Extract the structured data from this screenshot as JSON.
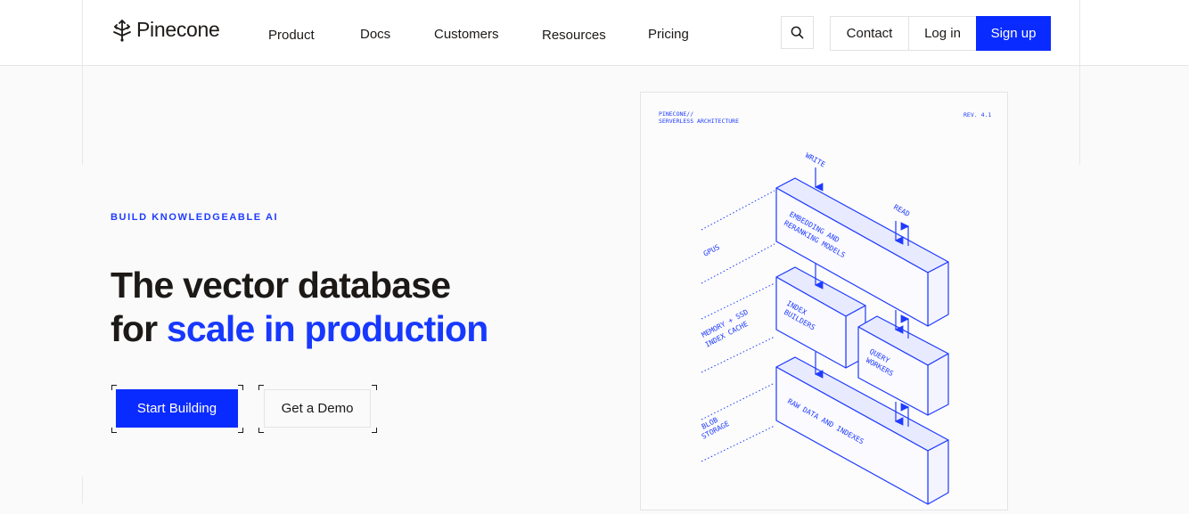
{
  "brand": {
    "name": "Pinecone",
    "logo_icon": "pinecone-logo-icon"
  },
  "nav": {
    "items": [
      "Product",
      "Docs",
      "Customers",
      "Resources",
      "Pricing"
    ]
  },
  "header_actions": {
    "search_icon": "search-icon",
    "contact": "Contact",
    "login": "Log in",
    "signup": "Sign up"
  },
  "hero": {
    "eyebrow": "BUILD KNOWLEDGEABLE AI",
    "headline_line1": "The vector database",
    "headline_line2_plain": "for ",
    "headline_line2_accent": "scale in production",
    "cta_primary": "Start Building",
    "cta_secondary": "Get a Demo"
  },
  "diagram": {
    "header_left_1": "PINECONE//",
    "header_left_2": "SERVERLESS ARCHITECTURE",
    "header_right": "REV. 4.1",
    "label_write": "WRITE",
    "label_read": "READ",
    "side_gpus": "GPUS",
    "side_memory_1": "MEMORY + SSD",
    "side_memory_2": "INDEX CACHE",
    "side_blob_1": "BLOB",
    "side_blob_2": "STORAGE",
    "box_embedding_1": "EMBEDDING AND",
    "box_embedding_2": "RERANKING MODELS",
    "box_index_1": "INDEX",
    "box_index_2": "BUILDERS",
    "box_query_1": "QUERY",
    "box_query_2": "WORKERS",
    "box_raw": "RAW DATA AND INDEXES"
  },
  "colors": {
    "accent": "#0a2bff",
    "text": "#1c1917",
    "bg": "#fafafa"
  }
}
